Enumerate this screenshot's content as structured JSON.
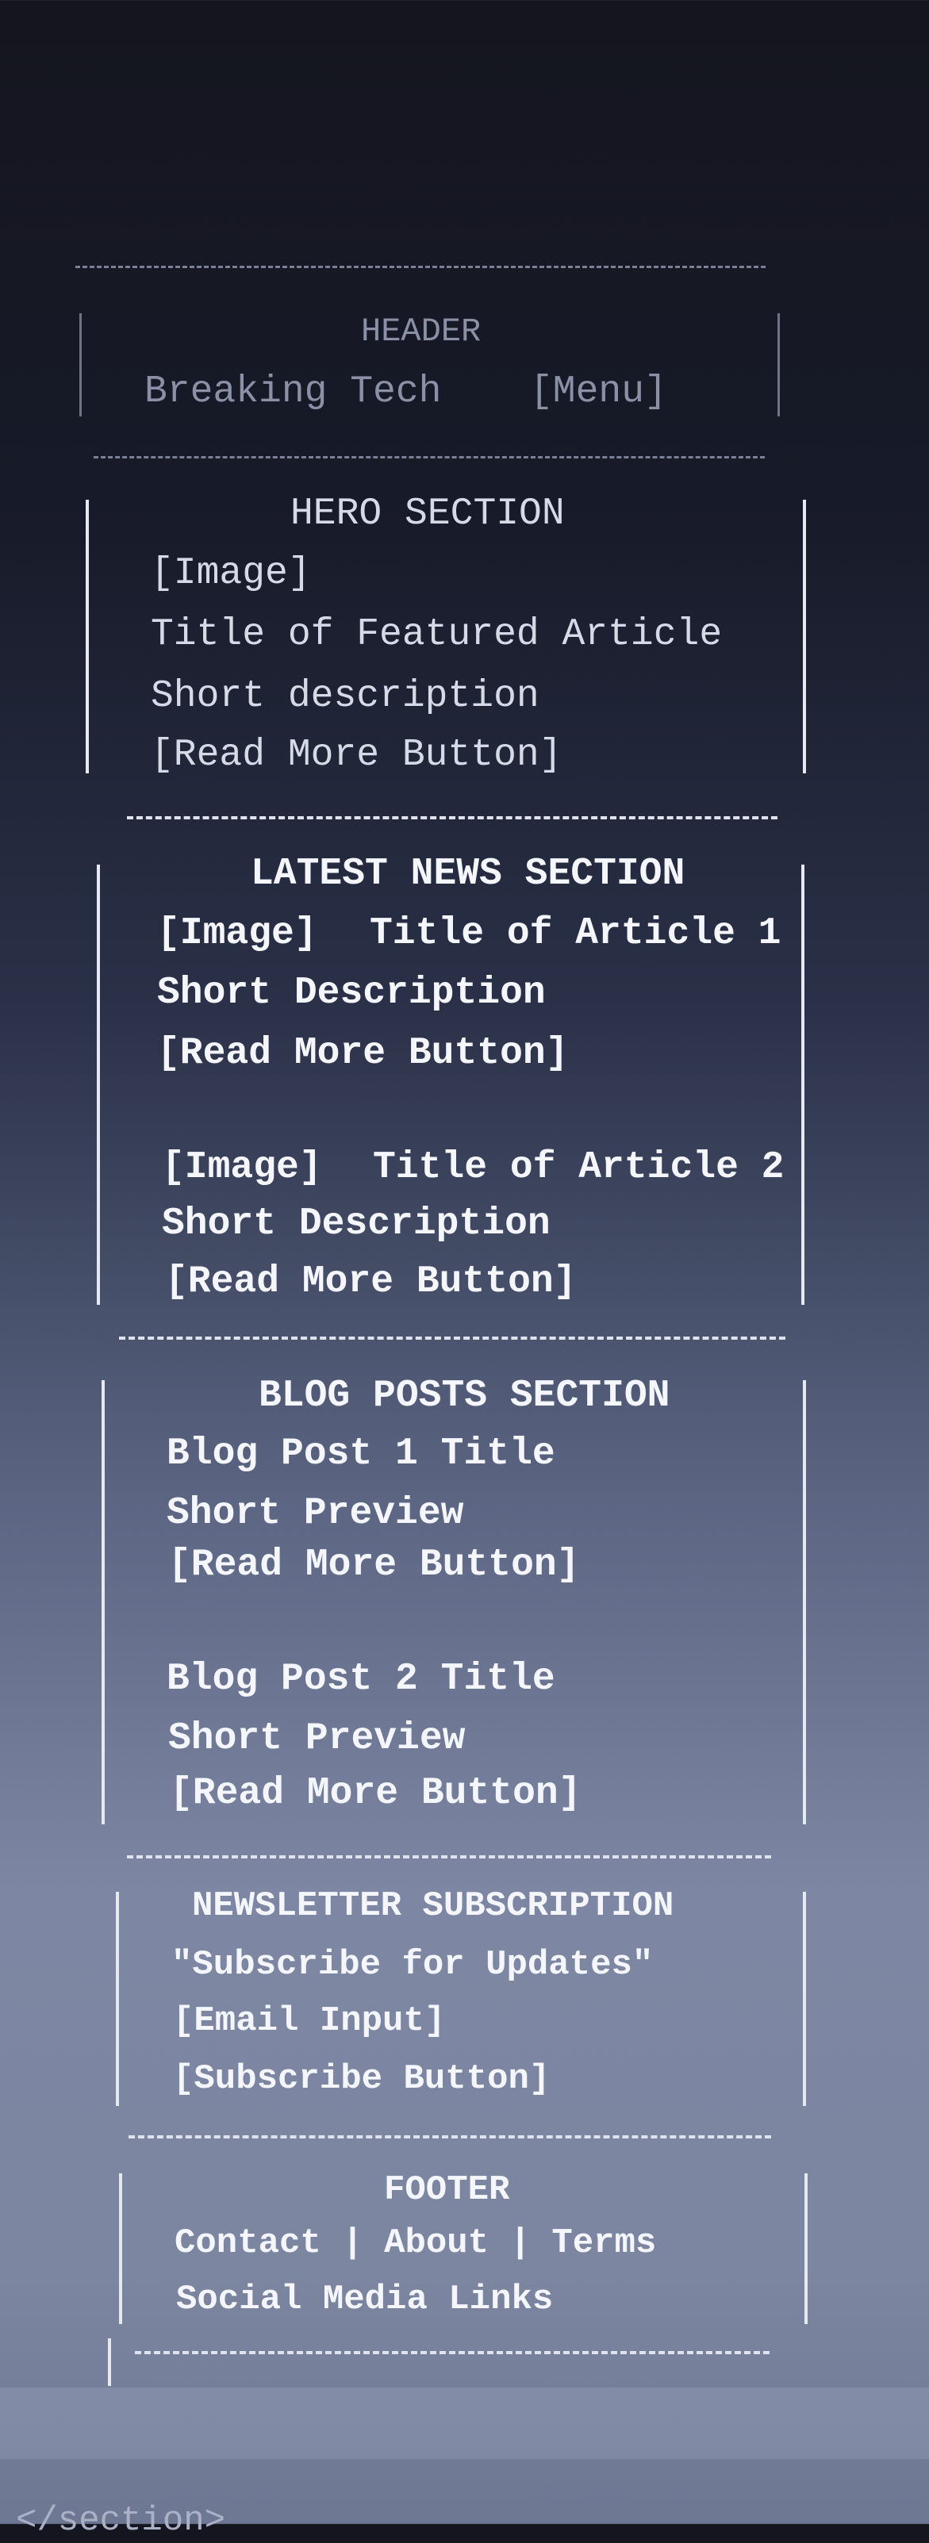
{
  "header": {
    "heading": "HEADER",
    "brand": "Breaking Tech",
    "menu": "[Menu]"
  },
  "hero": {
    "heading": "HERO SECTION",
    "image": "[Image]",
    "title": "Title of Featured Article",
    "description": "Short description",
    "button": "[Read More Button]"
  },
  "latest_news": {
    "heading": "LATEST NEWS SECTION",
    "articles": [
      {
        "image": "[Image]",
        "title": "Title of Article 1",
        "description": "Short Description",
        "button": "[Read More Button]"
      },
      {
        "image": "[Image]",
        "title": "Title of Article 2",
        "description": "Short Description",
        "button": "[Read More Button]"
      }
    ]
  },
  "blog_posts": {
    "heading": "BLOG POSTS SECTION",
    "posts": [
      {
        "title": "Blog Post 1 Title",
        "preview": "Short Preview",
        "button": "[Read More Button]"
      },
      {
        "title": "Blog Post 2 Title",
        "preview": "Short Preview",
        "button": "[Read More Button]"
      }
    ]
  },
  "newsletter": {
    "heading": "NEWSLETTER SUBSCRIPTION",
    "tagline": "\"Subscribe for Updates\"",
    "email_input": "[Email Input]",
    "button": "[Subscribe Button]"
  },
  "footer": {
    "heading": "FOOTER",
    "links": [
      "Contact",
      "About",
      "Terms"
    ],
    "separator": "|",
    "social": "Social Media Links"
  },
  "code": {
    "closing_tag": "</section>"
  }
}
